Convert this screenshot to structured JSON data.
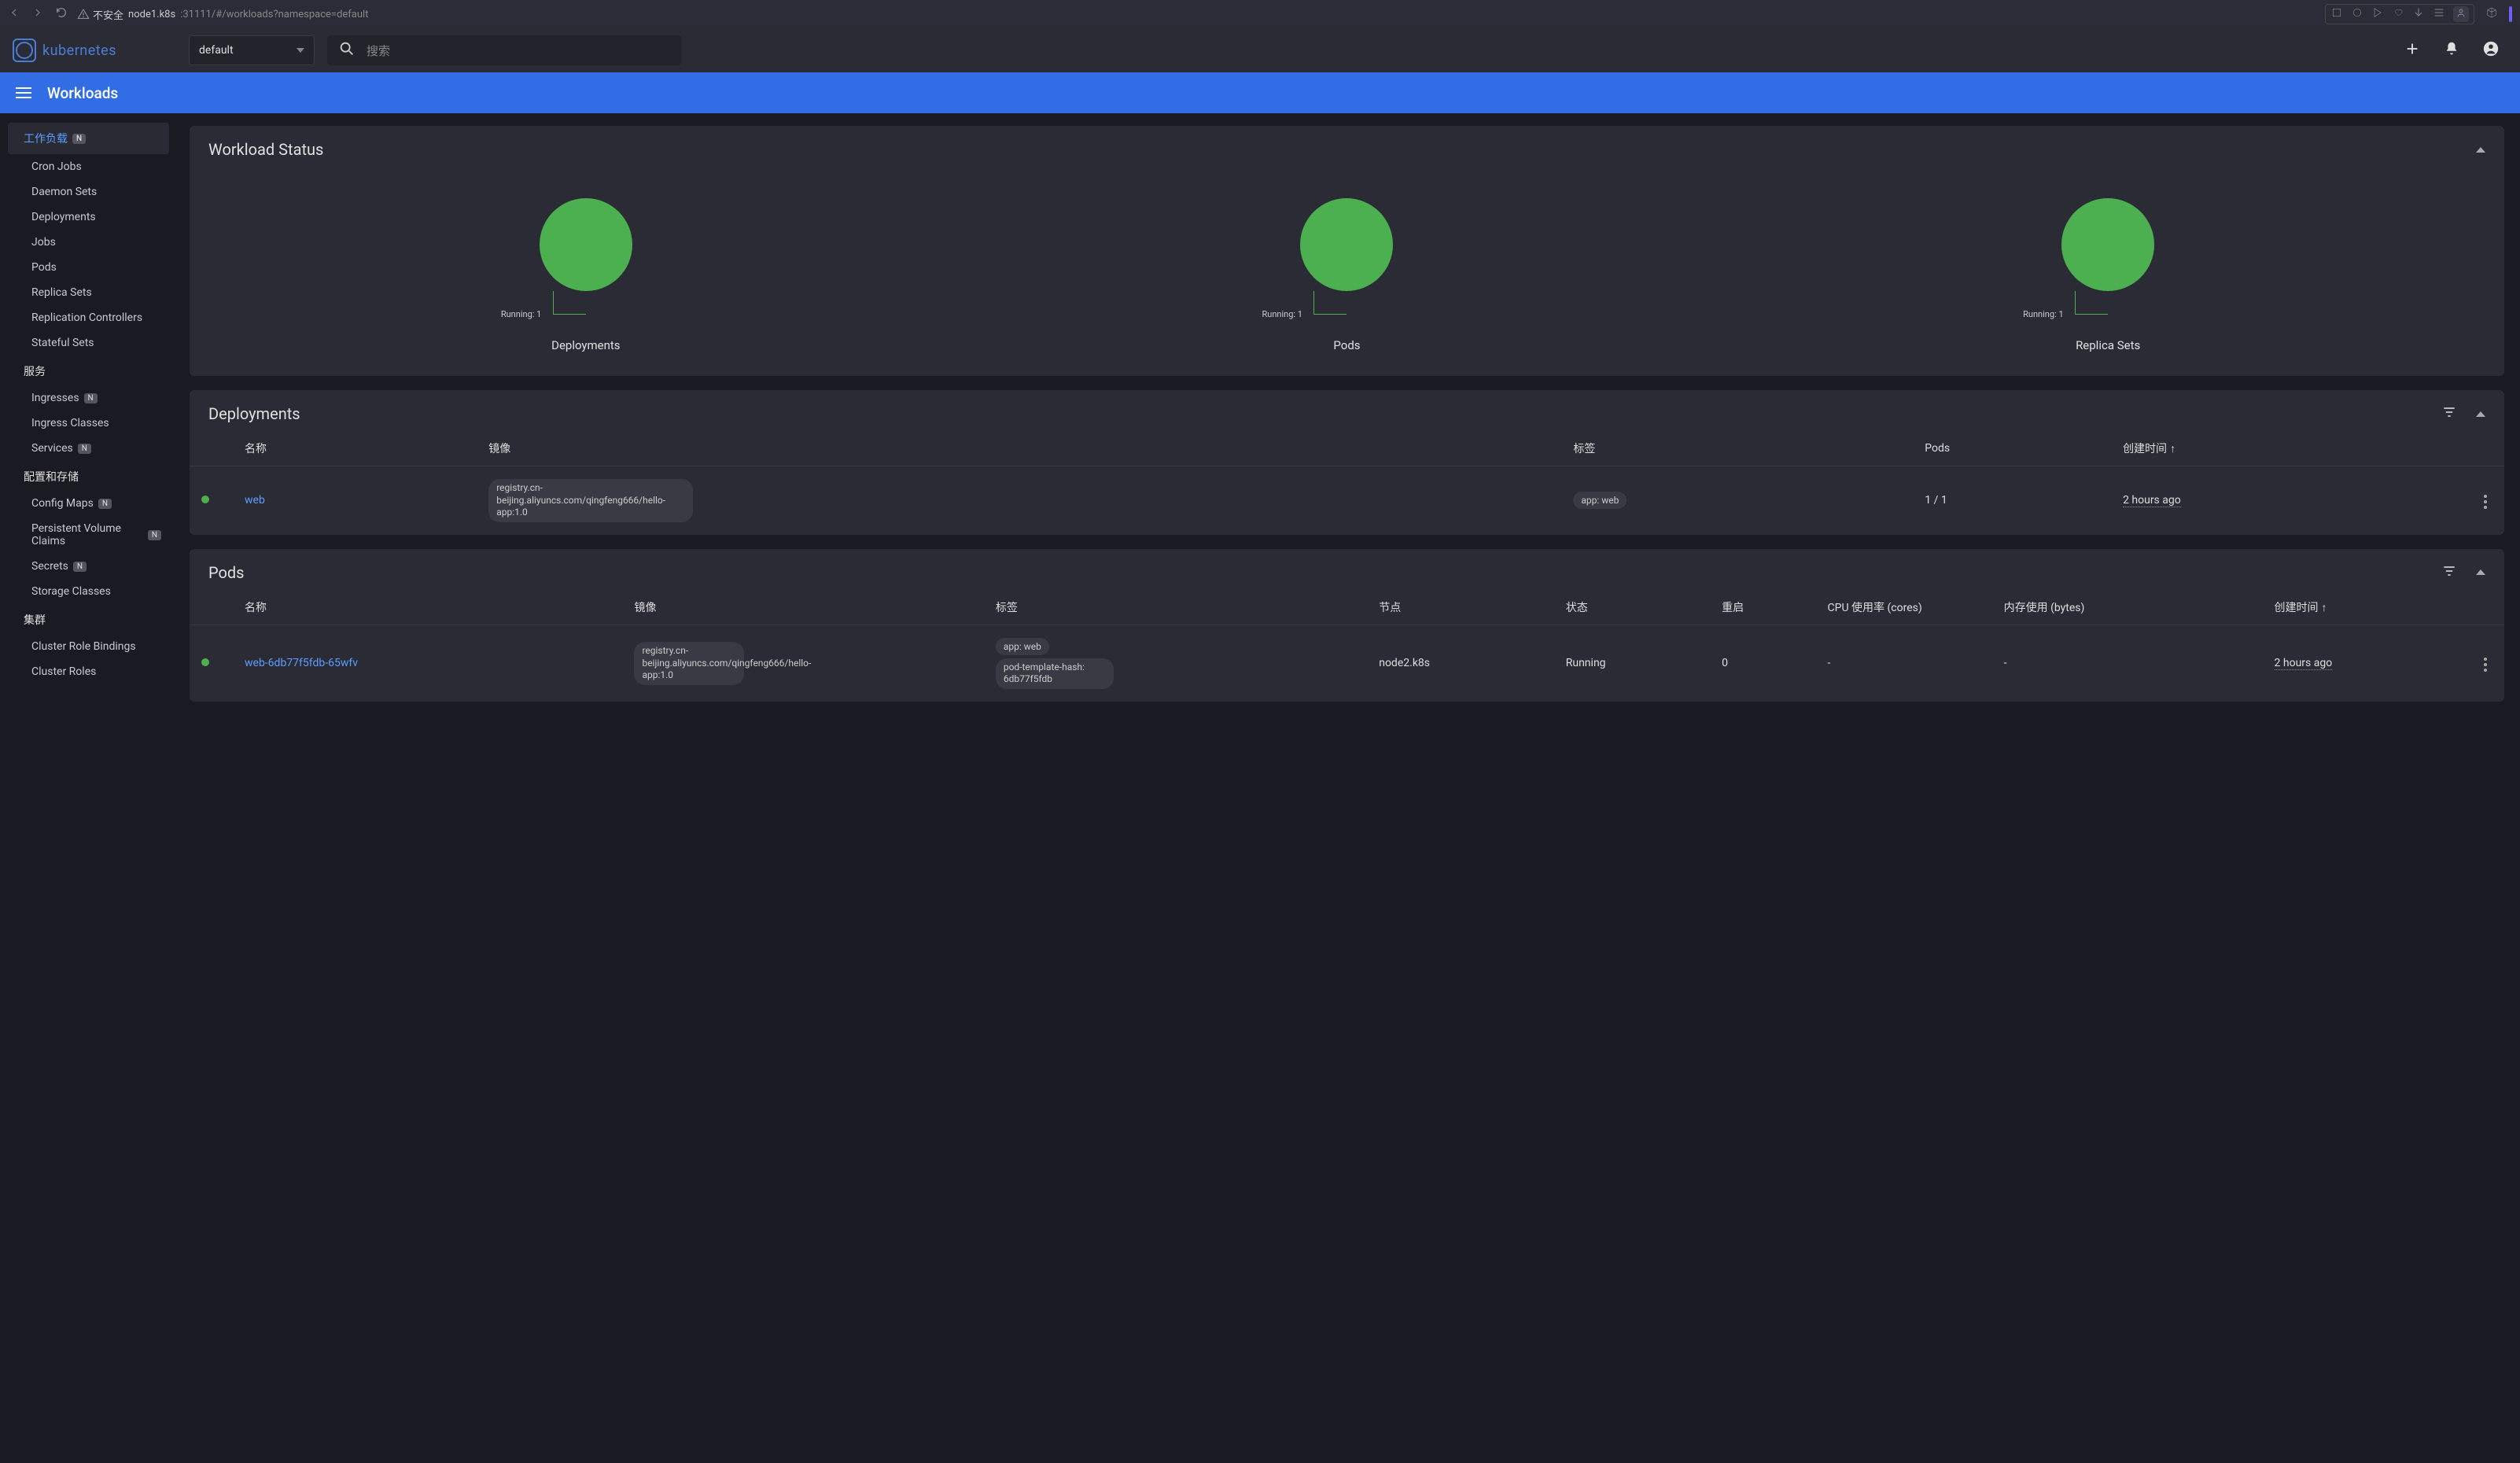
{
  "browser": {
    "insecure": "不安全",
    "host": "node1.k8s",
    "port_path": ":31111/#/workloads?namespace=default"
  },
  "header": {
    "logo_text": "kubernetes",
    "namespace_selected": "default",
    "search_placeholder": "搜索"
  },
  "titlebar": {
    "title": "Workloads"
  },
  "sidebar": {
    "workloads_title": "工作负载",
    "workloads_items": [
      {
        "label": "Cron Jobs"
      },
      {
        "label": "Daemon Sets"
      },
      {
        "label": "Deployments"
      },
      {
        "label": "Jobs"
      },
      {
        "label": "Pods"
      },
      {
        "label": "Replica Sets"
      },
      {
        "label": "Replication Controllers"
      },
      {
        "label": "Stateful Sets"
      }
    ],
    "services_title": "服务",
    "services_items": [
      {
        "label": "Ingresses",
        "badge": "N"
      },
      {
        "label": "Ingress Classes"
      },
      {
        "label": "Services",
        "badge": "N"
      }
    ],
    "config_title": "配置和存储",
    "config_items": [
      {
        "label": "Config Maps",
        "badge": "N"
      },
      {
        "label": "Persistent Volume Claims",
        "badge": "N"
      },
      {
        "label": "Secrets",
        "badge": "N"
      },
      {
        "label": "Storage Classes"
      }
    ],
    "cluster_title": "集群",
    "cluster_items": [
      {
        "label": "Cluster Role Bindings"
      },
      {
        "label": "Cluster Roles"
      }
    ]
  },
  "chart_data": [
    {
      "type": "pie",
      "title": "Deployments",
      "series": [
        {
          "name": "Running",
          "value": 1
        }
      ],
      "total": 1,
      "label": "Running: 1"
    },
    {
      "type": "pie",
      "title": "Pods",
      "series": [
        {
          "name": "Running",
          "value": 1
        }
      ],
      "total": 1,
      "label": "Running: 1"
    },
    {
      "type": "pie",
      "title": "Replica Sets",
      "series": [
        {
          "name": "Running",
          "value": 1
        }
      ],
      "total": 1,
      "label": "Running: 1"
    }
  ],
  "workload_status": {
    "title": "Workload Status"
  },
  "deployments": {
    "title": "Deployments",
    "columns": {
      "name": "名称",
      "image": "镜像",
      "labels": "标签",
      "pods": "Pods",
      "created": "创建时间"
    },
    "rows": [
      {
        "name": "web",
        "image": "registry.cn-beijing.aliyuncs.com/qingfeng666/hello-app:1.0",
        "labels": [
          "app: web"
        ],
        "pods": "1 / 1",
        "created": "2 hours ago"
      }
    ]
  },
  "pods": {
    "title": "Pods",
    "columns": {
      "name": "名称",
      "image": "镜像",
      "labels": "标签",
      "node": "节点",
      "status": "状态",
      "restarts": "重启",
      "cpu": "CPU 使用率 (cores)",
      "mem": "内存使用 (bytes)",
      "created": "创建时间"
    },
    "rows": [
      {
        "name": "web-6db77f5fdb-65wfv",
        "image": "registry.cn-beijing.aliyuncs.com/qingfeng666/hello-app:1.0",
        "labels": [
          "app: web",
          "pod-template-hash: 6db77f5fdb"
        ],
        "node": "node2.k8s",
        "status": "Running",
        "restarts": "0",
        "cpu": "-",
        "mem": "-",
        "created": "2 hours ago"
      }
    ]
  }
}
